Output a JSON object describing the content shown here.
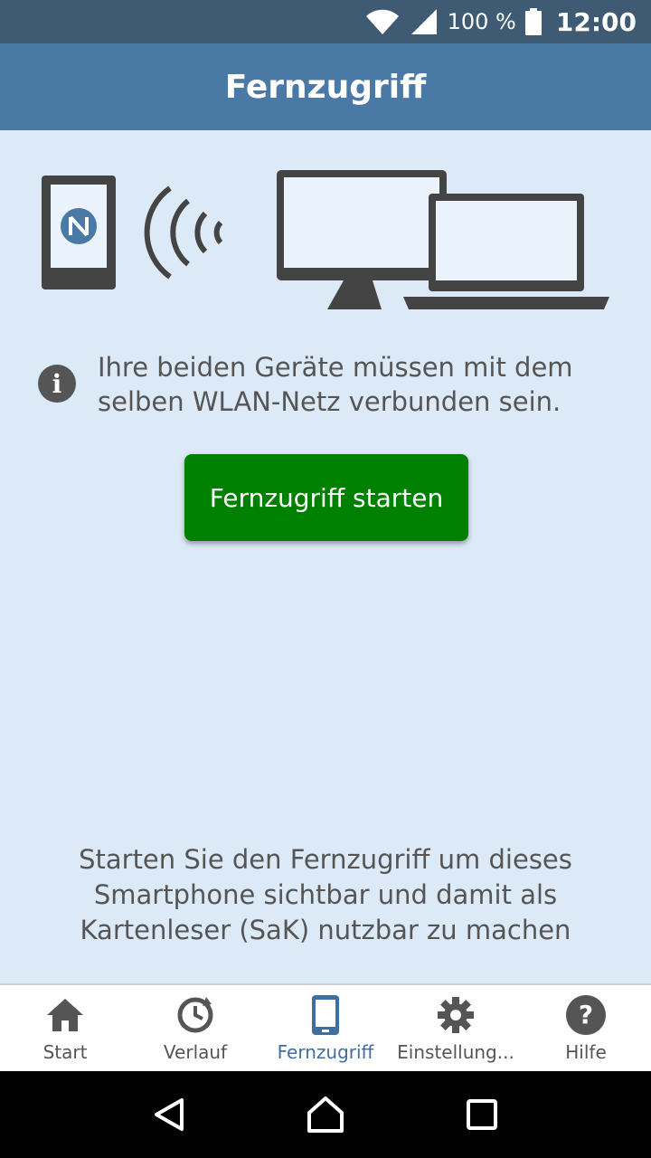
{
  "status_bar": {
    "battery": "100 %",
    "time": "12:00",
    "icons": [
      "wifi-icon",
      "signal-icon",
      "battery-icon"
    ]
  },
  "app_bar": {
    "title": "Fernzugriff"
  },
  "illustration": {
    "icons": [
      "phone-nfc-icon",
      "wireless-waves-icon",
      "monitor-icon",
      "laptop-icon"
    ]
  },
  "info": {
    "icon": "info-icon",
    "text": "Ihre beiden Geräte müssen mit dem selben WLAN-Netz verbunden sein."
  },
  "start_button": {
    "label": "Fernzugriff starten",
    "color": "#008000"
  },
  "bottom_text": "Starten Sie den Fernzugriff um dieses Smartphone sichtbar und damit als Kartenleser (SaK) nutzbar zu machen",
  "tabs": [
    {
      "label": "Start",
      "icon": "home-icon",
      "active": false
    },
    {
      "label": "Verlauf",
      "icon": "history-icon",
      "active": false
    },
    {
      "label": "Fernzugriff",
      "icon": "smartphone-icon",
      "active": true
    },
    {
      "label": "Einstellung...",
      "icon": "gear-icon",
      "active": false
    },
    {
      "label": "Hilfe",
      "icon": "help-icon",
      "active": false
    }
  ],
  "colors": {
    "status_bar": "#3f5a73",
    "app_bar": "#4a79a6",
    "background": "#dce9f6",
    "active_tab": "#3f6fa0"
  },
  "navigation": [
    "back-icon",
    "home-nav-icon",
    "recents-icon"
  ]
}
